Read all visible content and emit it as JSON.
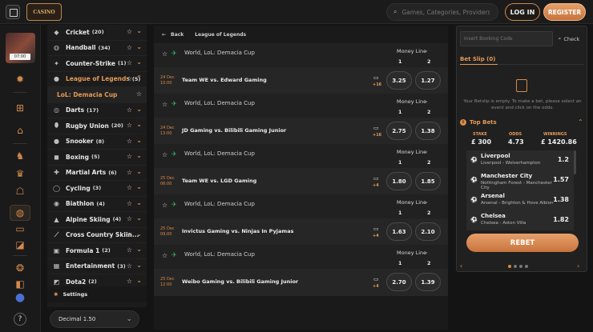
{
  "header": {
    "logo_text": "CASINO",
    "search_placeholder": "Games, Categories, Providers",
    "login_label": "LOG IN",
    "register_label": "REGISTER"
  },
  "promo": {
    "tag": "07:00"
  },
  "sports": [
    {
      "name": "Cricket",
      "count": "(20)",
      "icon": "cricket-icon",
      "glyph": "◆"
    },
    {
      "name": "Handball",
      "count": "(34)",
      "icon": "handball-icon",
      "glyph": "◍"
    },
    {
      "name": "Counter-Strike",
      "count": "(1)",
      "icon": "counter-strike-icon",
      "glyph": "✦"
    },
    {
      "name": "League of Legends",
      "count": "(5)",
      "icon": "league-of-legends-icon",
      "glyph": "●",
      "open": true
    },
    {
      "name": "LoL: Demacia Cup",
      "count": "",
      "icon": "",
      "glyph": "",
      "sub": true
    },
    {
      "name": "Darts",
      "count": "(17)",
      "icon": "darts-icon",
      "glyph": "◎"
    },
    {
      "name": "Rugby Union",
      "count": "(20)",
      "icon": "rugby-icon",
      "glyph": "⬮"
    },
    {
      "name": "Snooker",
      "count": "(8)",
      "icon": "snooker-icon",
      "glyph": "●"
    },
    {
      "name": "Boxing",
      "count": "(5)",
      "icon": "boxing-icon",
      "glyph": "◼"
    },
    {
      "name": "Martial Arts",
      "count": "(6)",
      "icon": "martial-arts-icon",
      "glyph": "✚"
    },
    {
      "name": "Cycling",
      "count": "(3)",
      "icon": "cycling-icon",
      "glyph": "◯"
    },
    {
      "name": "Biathlon",
      "count": "(4)",
      "icon": "biathlon-icon",
      "glyph": "◉"
    },
    {
      "name": "Alpine Skiing",
      "count": "(4)",
      "icon": "alpine-skiing-icon",
      "glyph": "▲"
    },
    {
      "name": "Cross Country Skiin...",
      "count": "",
      "icon": "cross-country-icon",
      "glyph": "⟋"
    },
    {
      "name": "Formula 1",
      "count": "(2)",
      "icon": "formula-1-icon",
      "glyph": "▣"
    },
    {
      "name": "Entertainment",
      "count": "(3)",
      "icon": "entertainment-icon",
      "glyph": "▦"
    },
    {
      "name": "Dota2",
      "count": "(2)",
      "icon": "dota2-icon",
      "glyph": "◩"
    }
  ],
  "settings_label": "Settings",
  "odds_format": "Decimal 1.50",
  "main": {
    "back_label": "Back",
    "breadcrumb": "League of Legends",
    "league_name": "World, LoL: Demacia Cup",
    "market": "Money Line",
    "col1": "1",
    "col2": "2",
    "matches": [
      {
        "date": "24 Dec",
        "time": "10:00",
        "teams": "Team WE vs. Edward Gaming",
        "plus": "+16",
        "o1": "3.25",
        "o2": "1.27"
      },
      {
        "date": "24 Dec",
        "time": "13:00",
        "teams": "JD Gaming vs. Bilibili Gaming Junior",
        "plus": "+16",
        "o1": "2.75",
        "o2": "1.38"
      },
      {
        "date": "25 Dec",
        "time": "06:00",
        "teams": "Team WE vs. LGD Gaming",
        "plus": "+4",
        "o1": "1.80",
        "o2": "1.85"
      },
      {
        "date": "25 Dec",
        "time": "09:00",
        "teams": "Invictus Gaming vs. Ninjas In Pyjamas",
        "plus": "+4",
        "o1": "1.63",
        "o2": "2.10"
      },
      {
        "date": "25 Dec",
        "time": "12:00",
        "teams": "Weibo Gaming vs. Bilibili Gaming Junior",
        "plus": "+4",
        "o1": "2.70",
        "o2": "1.39"
      }
    ]
  },
  "slip": {
    "code_placeholder": "Insert Booking Code",
    "check_label": "Check",
    "title": "Bet Slip (0)",
    "empty_text": "Your Betslip is empty. To make a bet, please select an event and click on the odds.",
    "top_bets_label": "Top Bets",
    "stake_label": "STAKE",
    "stake_value": "£ 300",
    "odds_label": "ODDS",
    "odds_value": "4.73",
    "winnings_label": "WINNINGS",
    "winnings_value": "£ 1420.86",
    "picks": [
      {
        "team": "Liverpool",
        "event": "Liverpool - Wolverhampton",
        "odd": "1.2"
      },
      {
        "team": "Manchester City",
        "event": "Nottingham Forest - Manchester City",
        "odd": "1.57"
      },
      {
        "team": "Arsenal",
        "event": "Arsenal - Brighton & Hove Albion",
        "odd": "1.38"
      },
      {
        "team": "Chelsea",
        "event": "Chelsea - Aston Villa",
        "odd": "1.82"
      }
    ],
    "rebet_label": "REBET"
  }
}
